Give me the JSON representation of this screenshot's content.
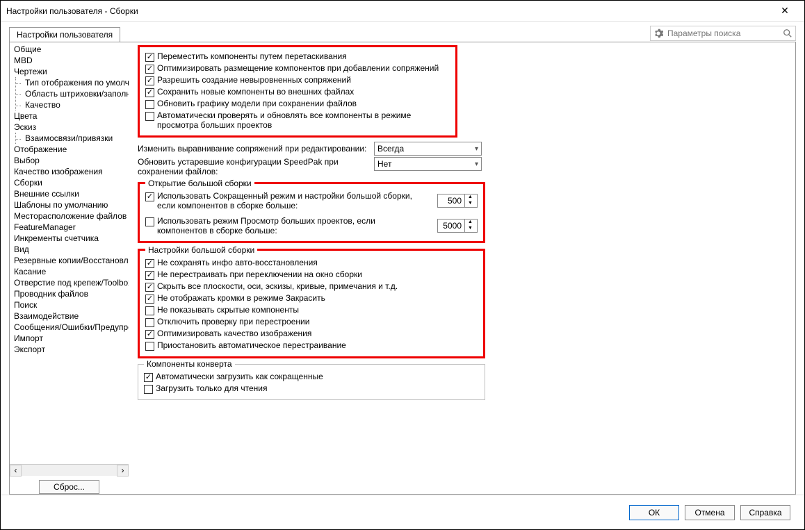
{
  "window": {
    "title": "Настройки пользователя - Сборки"
  },
  "search": {
    "placeholder": "Параметры поиска"
  },
  "tab": {
    "label": "Настройки пользователя"
  },
  "tree": {
    "items": [
      "Общие",
      "MBD",
      "Чертежи",
      "Цвета",
      "Эскиз",
      "Отображение",
      "Выбор",
      "Качество изображения",
      "Сборки",
      "Внешние ссылки",
      "Шаблоны по умолчанию",
      "Месторасположение файлов",
      "FeatureManager",
      "Инкременты счетчика",
      "Вид",
      "Резервные копии/Восстановление",
      "Касание",
      "Отверстие под крепеж/Toolbox",
      "Проводник файлов",
      "Поиск",
      "Взаимодействие",
      "Сообщения/Ошибки/Предупреждения",
      "Импорт",
      "Экспорт"
    ],
    "sub_drawings": [
      "Тип отображения по умолчанию",
      "Область штриховки/заполнения",
      "Качество"
    ],
    "sub_sketch": [
      "Взаимосвязи/привязки"
    ]
  },
  "reset_btn": "Сброс...",
  "top_checks": [
    {
      "checked": true,
      "label": "Переместить компоненты путем перетаскивания"
    },
    {
      "checked": true,
      "label": "Оптимизировать размещение компонентов при добавлении сопряжений"
    },
    {
      "checked": true,
      "label": "Разрешить создание невыровненных сопряжений"
    },
    {
      "checked": true,
      "label": "Сохранить новые компоненты во внешних файлах"
    },
    {
      "checked": false,
      "label": "Обновить графику модели при сохранении файлов"
    },
    {
      "checked": false,
      "label": "Автоматически проверять и обновлять все компоненты в режиме просмотра больших проектов"
    }
  ],
  "dd1": {
    "label": "Изменить выравнивание сопряжений при редактировании:",
    "value": "Всегда"
  },
  "dd2": {
    "label": "Обновить устаревшие конфигурации SpeedPak при сохранении файлов:",
    "value": "Нет"
  },
  "group_open": {
    "title": "Открытие большой сборки",
    "row1a": "Использовать Сокращенный режим и настройки большой сборки,",
    "row1b": "если компонентов в сборке больше:",
    "row1_checked": true,
    "val1": "500",
    "row2a": "Использовать режим Просмотр больших проектов, если компонентов в сборке больше:",
    "row2_checked": false,
    "val2": "5000"
  },
  "group_settings": {
    "title": "Настройки большой сборки",
    "checks": [
      {
        "checked": true,
        "label": "Не сохранять инфо авто-восстановления"
      },
      {
        "checked": true,
        "label": "Не перестраивать при переключении на окно сборки"
      },
      {
        "checked": true,
        "label": "Скрыть все плоскости, оси, эскизы, кривые, примечания и т.д."
      },
      {
        "checked": true,
        "label": "Не отображать кромки в режиме Закрасить"
      },
      {
        "checked": false,
        "label": "Не показывать скрытые компоненты"
      },
      {
        "checked": false,
        "label": "Отключить проверку при перестроении"
      },
      {
        "checked": true,
        "label": "Оптимизировать качество изображения"
      },
      {
        "checked": false,
        "label": "Приостановить автоматическое перестраивание"
      }
    ]
  },
  "group_env": {
    "title": "Компоненты конверта",
    "checks": [
      {
        "checked": true,
        "label": "Автоматически загрузить как сокращенные"
      },
      {
        "checked": false,
        "label": "Загрузить только для чтения"
      }
    ]
  },
  "footer": {
    "ok": "ОК",
    "cancel": "Отмена",
    "help": "Справка"
  }
}
